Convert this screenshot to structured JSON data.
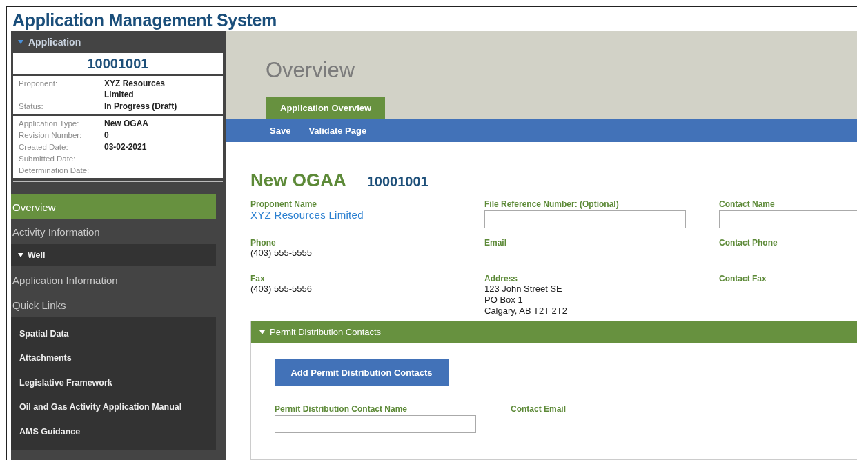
{
  "app_title": "Application Management System",
  "sidebar": {
    "section_title": "Application",
    "section_expanded": true,
    "application_id": "10001001",
    "summary": [
      {
        "label": "Proponent:",
        "value": "XYZ Resources Limited"
      },
      {
        "label": "Status:",
        "value": "In Progress (Draft)"
      }
    ],
    "details": [
      {
        "label": "Application Type:",
        "value": "New OGAA"
      },
      {
        "label": "Revision Number:",
        "value": "0"
      },
      {
        "label": "Created Date:",
        "value": "03-02-2021"
      },
      {
        "label": "Submitted Date:"
      },
      {
        "label": "Determination Date:"
      }
    ],
    "nav": [
      {
        "kind": "item",
        "label": "Overview",
        "selected": true
      },
      {
        "kind": "item",
        "label": "Activity Information",
        "selected": false
      },
      {
        "kind": "group",
        "label": "Well",
        "expanded": true
      },
      {
        "kind": "item",
        "label": "Application Information",
        "selected": false
      },
      {
        "kind": "item",
        "label": "Quick Links",
        "selected": false
      }
    ],
    "quick_links": [
      "Spatial Data",
      "Attachments",
      "Legislative Framework",
      "Oil and Gas Activity Application Manual",
      "AMS Guidance"
    ]
  },
  "page_title": "Overview",
  "tabs": [
    {
      "label": "Application Overview",
      "selected": true
    }
  ],
  "toolbar": [
    "Save",
    "Validate Page"
  ],
  "heading": {
    "title": "New OGAA",
    "id": "10001001"
  },
  "fields": [
    {
      "kind": "link",
      "label": "Proponent Name",
      "value": "XYZ Resources Limited"
    },
    {
      "kind": "input",
      "label": "File Reference Number: (Optional)"
    },
    {
      "kind": "input",
      "label": "Contact Name"
    },
    {
      "kind": "text",
      "label": "Phone",
      "lines": [
        "(403) 555-5555"
      ]
    },
    {
      "kind": "text",
      "label": "Email"
    },
    {
      "kind": "text",
      "label": "Contact Phone"
    },
    {
      "kind": "text",
      "label": "Fax",
      "lines": [
        "(403) 555-5556"
      ]
    },
    {
      "kind": "text",
      "label": "Address",
      "lines": [
        "123 John Street SE",
        "PO Box 1",
        "Calgary, AB T2T 2T2"
      ]
    },
    {
      "kind": "text",
      "label": "Contact Fax"
    }
  ],
  "permit_section": {
    "title": "Permit Distribution Contacts",
    "expanded": true,
    "add_button": "Add Permit Distribution Contacts",
    "fields": [
      {
        "kind": "input",
        "label": "Permit Distribution Contact Name"
      },
      {
        "kind": "text",
        "label": "Contact Email"
      }
    ]
  }
}
